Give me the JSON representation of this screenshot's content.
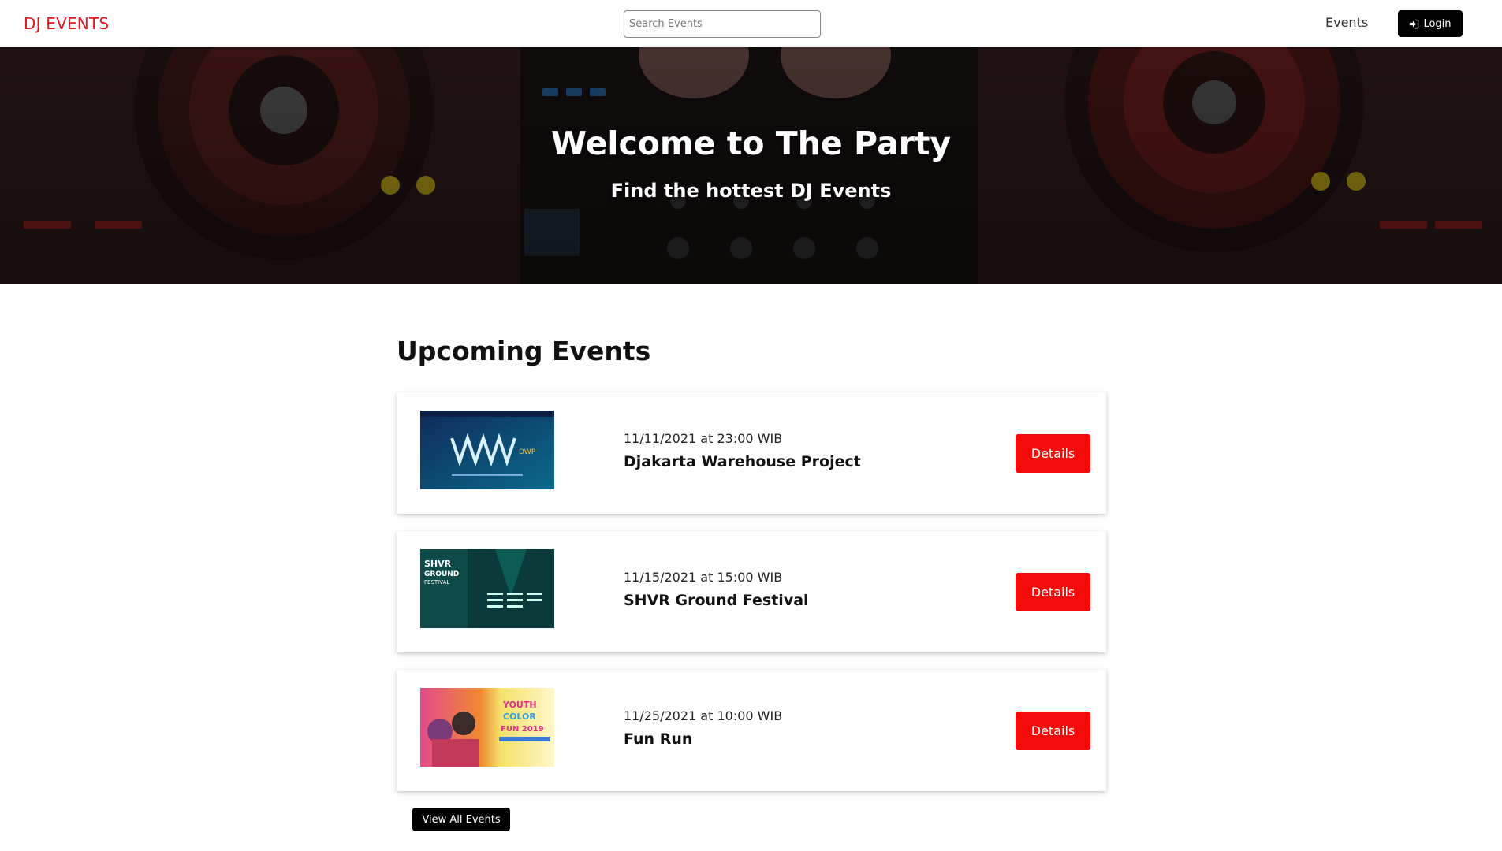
{
  "header": {
    "logo": "DJ EVENTS",
    "search_placeholder": "Search Events",
    "nav_events": "Events",
    "login_label": "Login",
    "login_icon": "sign-in-icon"
  },
  "hero": {
    "title": "Welcome to The Party",
    "subtitle": "Find the hottest DJ Events"
  },
  "main": {
    "section_title": "Upcoming Events",
    "events": [
      {
        "date": "11/11/2021 at 23:00 WIB",
        "name": "Djakarta Warehouse Project",
        "button": "Details",
        "thumb_text": "DWP"
      },
      {
        "date": "11/15/2021 at 15:00 WIB",
        "name": "SHVR Ground Festival",
        "button": "Details",
        "thumb_text": "SHVR GROUND FESTIVAL"
      },
      {
        "date": "11/25/2021 at 10:00 WIB",
        "name": "Fun Run",
        "button": "Details",
        "thumb_text": "YOUTH COLOR FUN 2019"
      }
    ],
    "view_all": "View All Events"
  },
  "colors": {
    "brand_red": "#e3171e",
    "button_red": "#f50a0a",
    "black": "#000000"
  }
}
